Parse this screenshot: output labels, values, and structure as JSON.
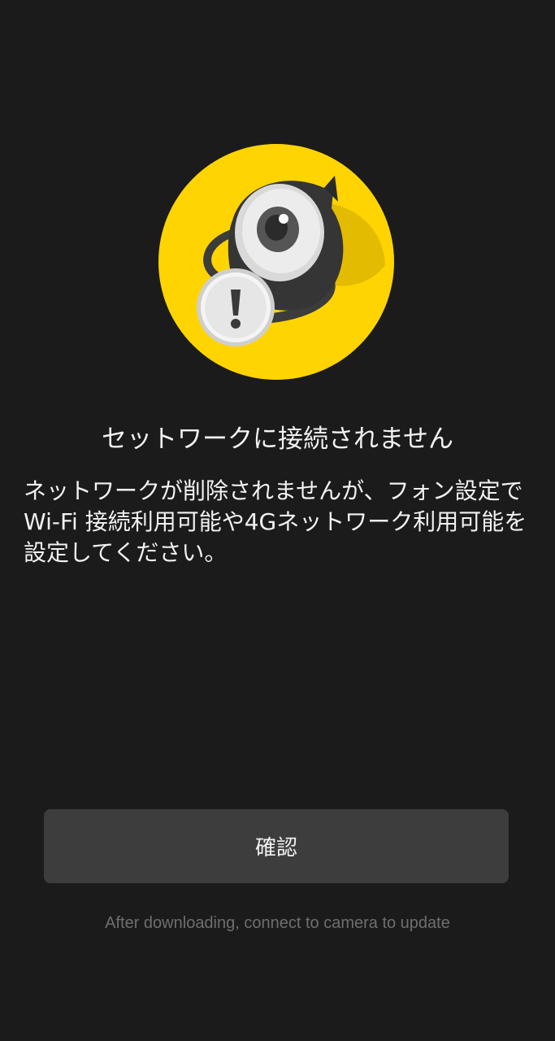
{
  "illustration": {
    "icon": "disconnected-camera-alert-icon",
    "badge_icon": "exclamation-icon",
    "background_color": "#FFD400"
  },
  "dialog": {
    "title": "セットワークに接続されません",
    "message": "ネットワークが削除されませんが、フォン設定でWi-Fi 接続利用可能や4Gネットワーク利用可能を設定してください。"
  },
  "confirm_button": {
    "label": "確認"
  },
  "footer": {
    "hint": "After downloading, connect to camera to update"
  },
  "colors": {
    "background": "#1B1B1B",
    "button": "#3D3D3D",
    "accent": "#FFD400",
    "text": "#F2F2F2",
    "hint_text": "#6E6E6E"
  }
}
